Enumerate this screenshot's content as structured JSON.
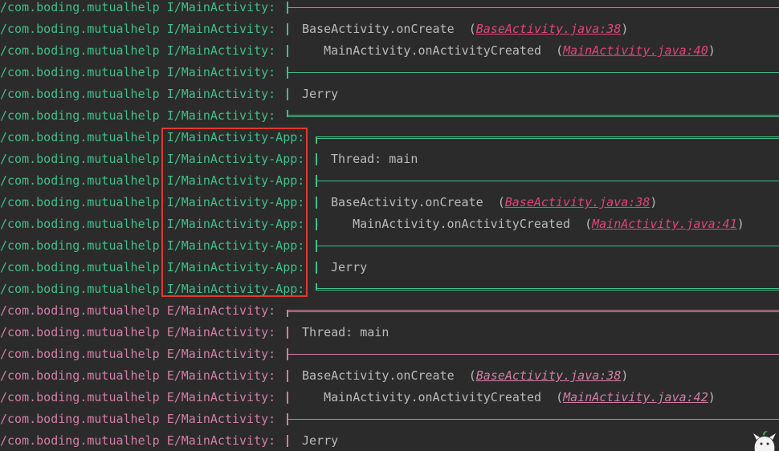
{
  "colors": {
    "info": "#3fbf8a",
    "error": "#d27fa5",
    "text": "#bbbbbb",
    "background": "#2b2b2b",
    "highlight": "#e0392f"
  },
  "rows": [
    {
      "tag": "/com.boding.mutualhelp I/MainActivity:",
      "level": "info",
      "kind": "mid",
      "line": ""
    },
    {
      "tag": "/com.boding.mutualhelp I/MainActivity:",
      "level": "info",
      "kind": "text",
      "line": "BaseActivity.onCreate  (",
      "link": "BaseActivity.java:38",
      "tail": ")"
    },
    {
      "tag": "/com.boding.mutualhelp I/MainActivity:",
      "level": "info",
      "kind": "text",
      "line": "   MainActivity.onActivityCreated  (",
      "link": "MainActivity.java:40",
      "tail": ")"
    },
    {
      "tag": "/com.boding.mutualhelp I/MainActivity:",
      "level": "info",
      "kind": "mid",
      "line": ""
    },
    {
      "tag": "/com.boding.mutualhelp I/MainActivity:",
      "level": "info",
      "kind": "text",
      "line": "Jerry"
    },
    {
      "tag": "/com.boding.mutualhelp I/MainActivity:",
      "level": "info",
      "kind": "bot",
      "line": ""
    },
    {
      "tag": "/com.boding.mutualhelp I/MainActivity-App:",
      "level": "info",
      "kind": "top",
      "line": ""
    },
    {
      "tag": "/com.boding.mutualhelp I/MainActivity-App:",
      "level": "info",
      "kind": "text",
      "line": "Thread: main"
    },
    {
      "tag": "/com.boding.mutualhelp I/MainActivity-App:",
      "level": "info",
      "kind": "mid",
      "line": ""
    },
    {
      "tag": "/com.boding.mutualhelp I/MainActivity-App:",
      "level": "info",
      "kind": "text",
      "line": "BaseActivity.onCreate  (",
      "link": "BaseActivity.java:38",
      "tail": ")"
    },
    {
      "tag": "/com.boding.mutualhelp I/MainActivity-App:",
      "level": "info",
      "kind": "text",
      "line": "   MainActivity.onActivityCreated  (",
      "link": "MainActivity.java:41",
      "tail": ")"
    },
    {
      "tag": "/com.boding.mutualhelp I/MainActivity-App:",
      "level": "info",
      "kind": "mid",
      "line": ""
    },
    {
      "tag": "/com.boding.mutualhelp I/MainActivity-App:",
      "level": "info",
      "kind": "text",
      "line": "Jerry"
    },
    {
      "tag": "/com.boding.mutualhelp I/MainActivity-App:",
      "level": "info",
      "kind": "bot",
      "line": ""
    },
    {
      "tag": "/com.boding.mutualhelp E/MainActivity:",
      "level": "err",
      "kind": "top",
      "line": ""
    },
    {
      "tag": "/com.boding.mutualhelp E/MainActivity:",
      "level": "err",
      "kind": "text",
      "line": "Thread: main"
    },
    {
      "tag": "/com.boding.mutualhelp E/MainActivity:",
      "level": "err",
      "kind": "mid",
      "line": ""
    },
    {
      "tag": "/com.boding.mutualhelp E/MainActivity:",
      "level": "err",
      "kind": "text",
      "line": "BaseActivity.onCreate  (",
      "link": "BaseActivity.java:38",
      "tail": ")"
    },
    {
      "tag": "/com.boding.mutualhelp E/MainActivity:",
      "level": "err",
      "kind": "text",
      "line": "   MainActivity.onActivityCreated  (",
      "link": "MainActivity.java:42",
      "tail": ")"
    },
    {
      "tag": "/com.boding.mutualhelp E/MainActivity:",
      "level": "err",
      "kind": "mid",
      "line": ""
    },
    {
      "tag": "/com.boding.mutualhelp E/MainActivity:",
      "level": "err",
      "kind": "text",
      "line": "Jerry"
    }
  ]
}
